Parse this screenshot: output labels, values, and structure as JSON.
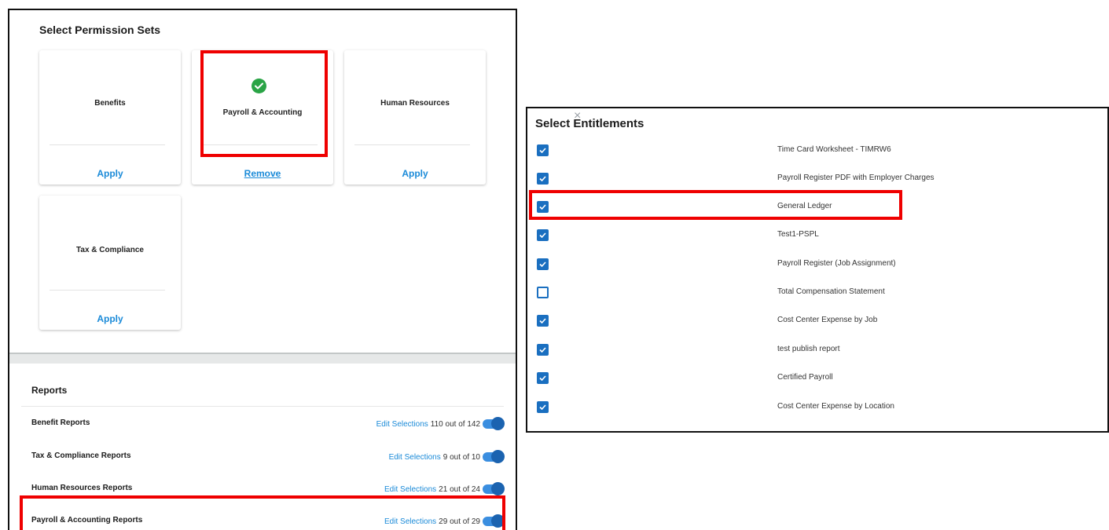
{
  "permission_sets": {
    "title": "Select Permission Sets",
    "cards": [
      {
        "label": "Benefits",
        "action": "Apply",
        "selected": false
      },
      {
        "label": "Payroll & Accounting",
        "action": "Remove",
        "selected": true
      },
      {
        "label": "Human Resources",
        "action": "Apply",
        "selected": false
      },
      {
        "label": "Tax & Compliance",
        "action": "Apply",
        "selected": false
      }
    ]
  },
  "reports": {
    "title": "Reports",
    "edit_label": "Edit Selections",
    "rows": [
      {
        "name": "Benefit Reports",
        "count": "110 out of 142",
        "enabled": true
      },
      {
        "name": "Tax & Compliance Reports",
        "count": "9 out of 10",
        "enabled": true
      },
      {
        "name": "Human Resources Reports",
        "count": "21 out of 24",
        "enabled": true
      },
      {
        "name": "Payroll & Accounting Reports",
        "count": "29 out of 29",
        "enabled": true
      }
    ]
  },
  "entitlements": {
    "title": "Select Entitlements",
    "close_glyph": "×",
    "items": [
      {
        "label": "Time Card Worksheet - TIMRW6",
        "checked": true
      },
      {
        "label": "Payroll Register PDF with Employer Charges",
        "checked": true
      },
      {
        "label": "General Ledger",
        "checked": true
      },
      {
        "label": "Test1-PSPL",
        "checked": true
      },
      {
        "label": "Payroll Register (Job Assignment)",
        "checked": true
      },
      {
        "label": "Total Compensation Statement",
        "checked": false
      },
      {
        "label": "Cost Center Expense by Job",
        "checked": true
      },
      {
        "label": "test publish report",
        "checked": true
      },
      {
        "label": "Certified Payroll",
        "checked": true
      },
      {
        "label": "Cost Center Expense by Location",
        "checked": true
      }
    ]
  },
  "colors": {
    "accent": "#1a8ad8",
    "success": "#2aa446",
    "highlight": "#ef0000",
    "checkbox": "#1a6fc0"
  },
  "icons": {
    "selected_check": "check-circle-icon",
    "checkbox_check": "checkmark-icon",
    "close": "close-icon"
  }
}
